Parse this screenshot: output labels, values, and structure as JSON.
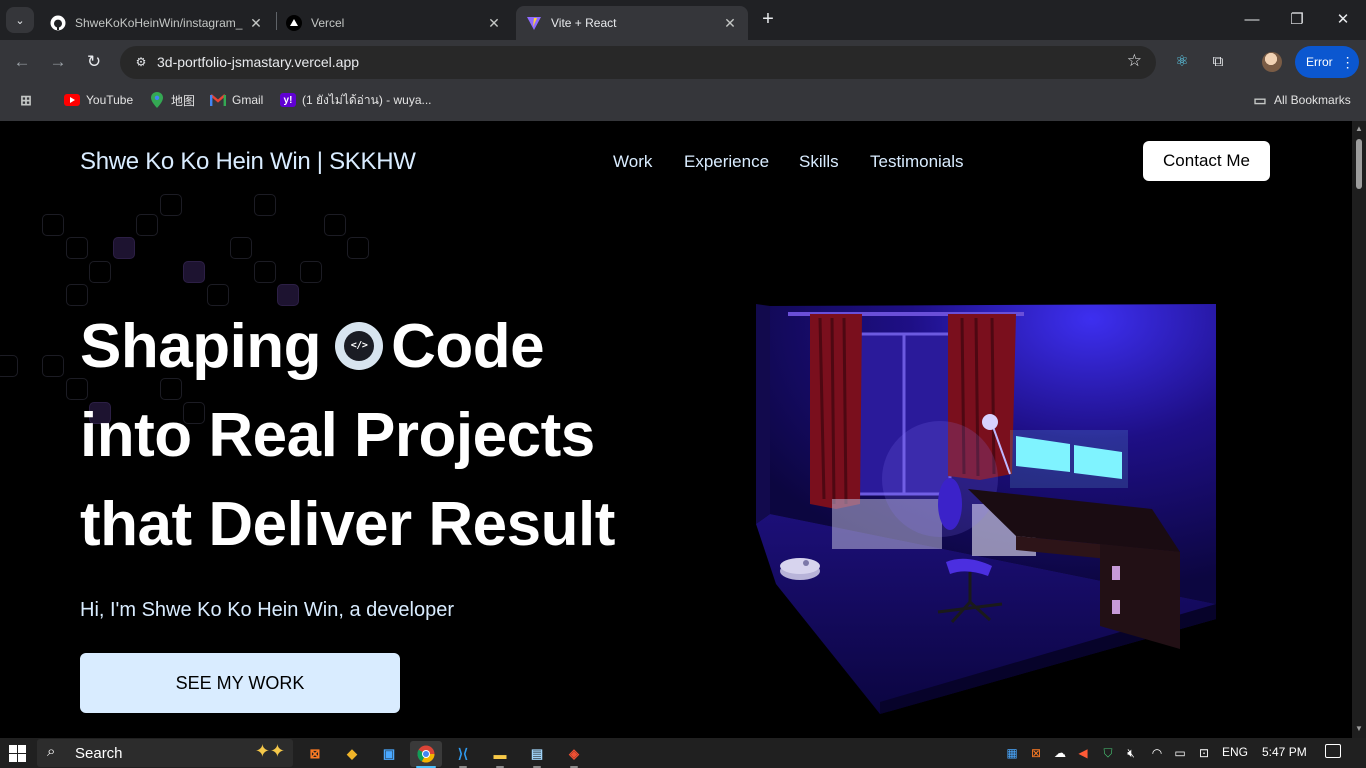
{
  "browser": {
    "tabs": [
      {
        "title": "ShweKoKoHeinWin/instagram_",
        "icon": "github-icon",
        "close": "✕"
      },
      {
        "title": "Vercel",
        "icon": "vercel-icon",
        "close": "✕"
      },
      {
        "title": "Vite + React",
        "icon": "vite-icon",
        "close": "✕"
      }
    ],
    "active_tab_index": 2,
    "new_tab_glyph": "+",
    "url": "3d-portfolio-jsmastary.vercel.app",
    "profile_button": "Error",
    "bookmarks": [
      {
        "label": "YouTube",
        "icon": "youtube-icon"
      },
      {
        "label": "地图",
        "icon": "maps-icon"
      },
      {
        "label": "Gmail",
        "icon": "gmail-icon"
      },
      {
        "label": "(1 ยังไม่ได้อ่าน) - wuya...",
        "icon": "yahoo-mail-icon"
      }
    ],
    "all_bookmarks": "All Bookmarks"
  },
  "site": {
    "brand": "Shwe Ko Ko Hein Win | SKKHW",
    "nav": [
      "Work",
      "Experience",
      "Skills",
      "Testimonials"
    ],
    "contact_button": "Contact Me",
    "hero": {
      "line1_word1": "Shaping",
      "line1_badge": "</>",
      "line1_word2": "Code",
      "line2": "into Real Projects",
      "line3": "that Deliver Result"
    },
    "subtitle": "Hi, I'm Shwe Ko Ko Hein Win, a developer",
    "cta": "SEE MY WORK"
  },
  "taskbar": {
    "search_label": "Search",
    "language": "ENG",
    "time": "5:47 PM"
  },
  "colors": {
    "accent_text": "#d9ecff",
    "browser_bg": "#35363a",
    "tab_strip": "#202124",
    "profile_button": "#0b57d0",
    "room_glow": "#3a1fd6"
  }
}
